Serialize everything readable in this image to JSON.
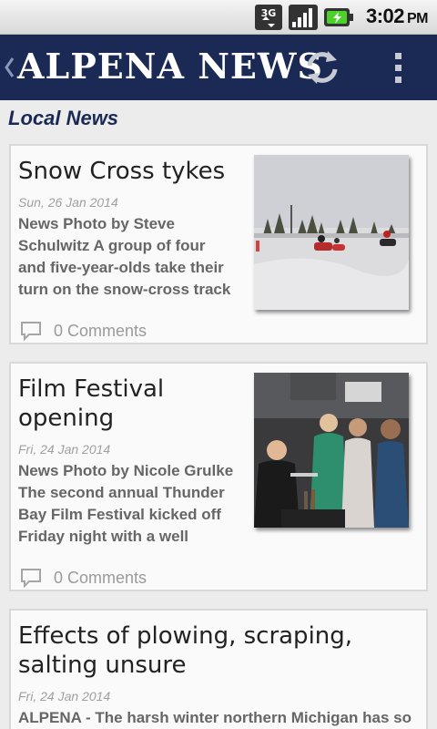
{
  "status_bar": {
    "network_label": "3G",
    "time": "3:02",
    "ampm": "PM",
    "icons": [
      "3g-data-icon",
      "signal-strength-icon",
      "battery-charging-icon"
    ]
  },
  "action_bar": {
    "app_title": "ALPENA NEWS",
    "bg_color": "#1b2a55",
    "icons": [
      "back-chevron-icon",
      "refresh-icon",
      "overflow-menu-icon"
    ]
  },
  "section": {
    "title": "Local News"
  },
  "articles": [
    {
      "title": "Snow Cross tykes",
      "date": "Sun, 26 Jan 2014",
      "summary": "News Photo by Steve Schulwitz A group of four and five-year-olds take their turn on the snow-cross track",
      "comments": "0 Comments",
      "thumbnail": "snowmobile-track-photo"
    },
    {
      "title": "Film Festival opening",
      "date": "Fri, 24 Jan 2014",
      "summary": "News Photo by Nicole Grulke The second annual Thunder Bay Film Festival kicked off Friday night with a well",
      "comments": "0 Comments",
      "thumbnail": "film-festival-crowd-photo"
    },
    {
      "title": "Effects of plowing, scraping, salting unsure",
      "date": "Fri, 24 Jan 2014",
      "summary": "ALPENA - The harsh winter northern Michigan has so"
    }
  ]
}
